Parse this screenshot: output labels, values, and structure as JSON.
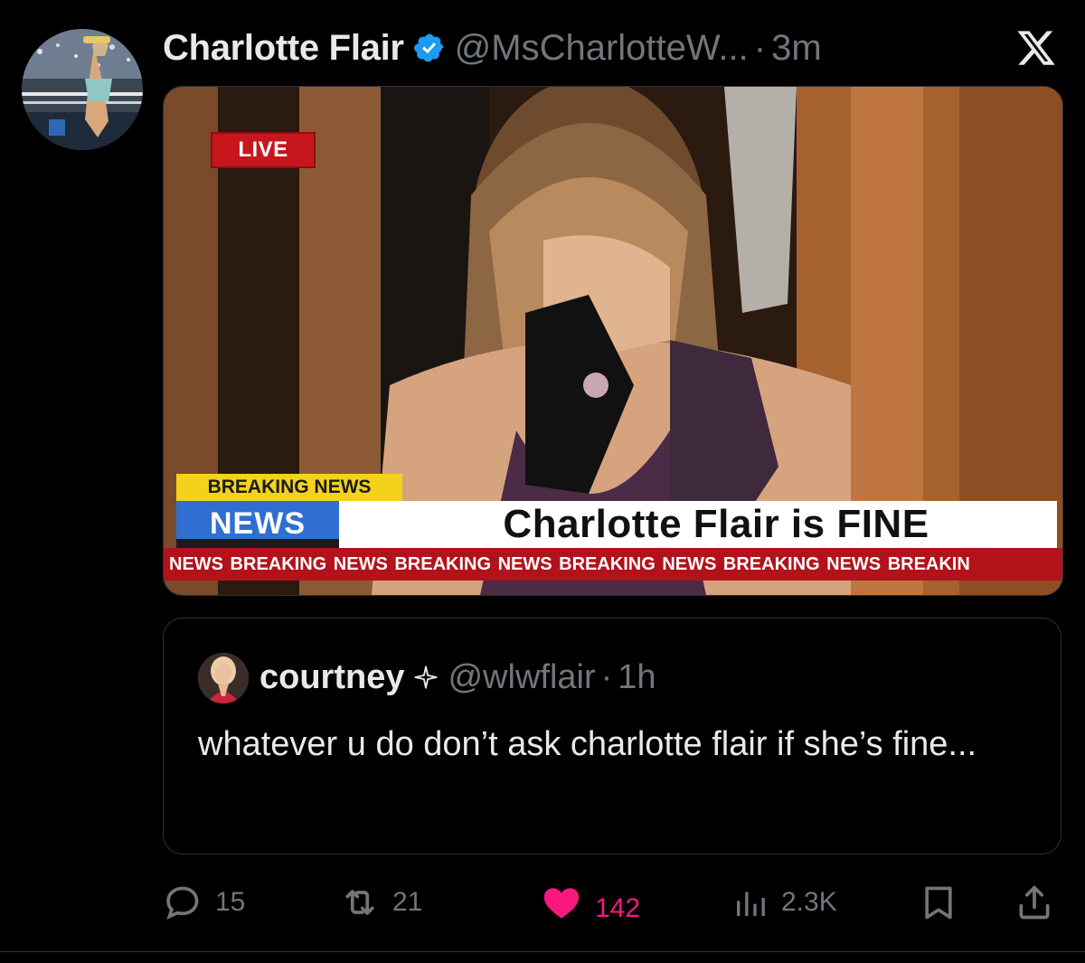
{
  "post": {
    "display_name": "Charlotte Flair",
    "handle": "@MsCharlotteW...",
    "separator": "·",
    "time": "3m",
    "verified": true
  },
  "media": {
    "live_label": "LIVE",
    "breaking_label": "BREAKING NEWS",
    "news_label": "NEWS",
    "headline": "Charlotte Flair is FINE",
    "ticker": "NEWS  BREAKING NEWS  BREAKING NEWS  BREAKING NEWS  BREAKING NEWS  BREAKIN"
  },
  "quoted_post": {
    "display_name": "courtney",
    "handle": "@wlwflair",
    "separator": "·",
    "time": "1h",
    "text": "whatever u do don’t ask charlotte flair if she’s fine..."
  },
  "actions": {
    "replies": "15",
    "reposts": "21",
    "likes": "142",
    "views": "2.3K"
  },
  "colors": {
    "background": "#000000",
    "text_primary": "#e7e9ea",
    "text_secondary": "#71767b",
    "verified_blue": "#1d9bf0",
    "like_pink": "#f91880",
    "border": "#2f3336"
  },
  "icons": [
    "verified-badge-icon",
    "x-logo-icon",
    "reply-icon",
    "repost-icon",
    "like-heart-icon",
    "views-icon",
    "bookmark-icon",
    "share-icon",
    "sparkle-badge-icon"
  ]
}
